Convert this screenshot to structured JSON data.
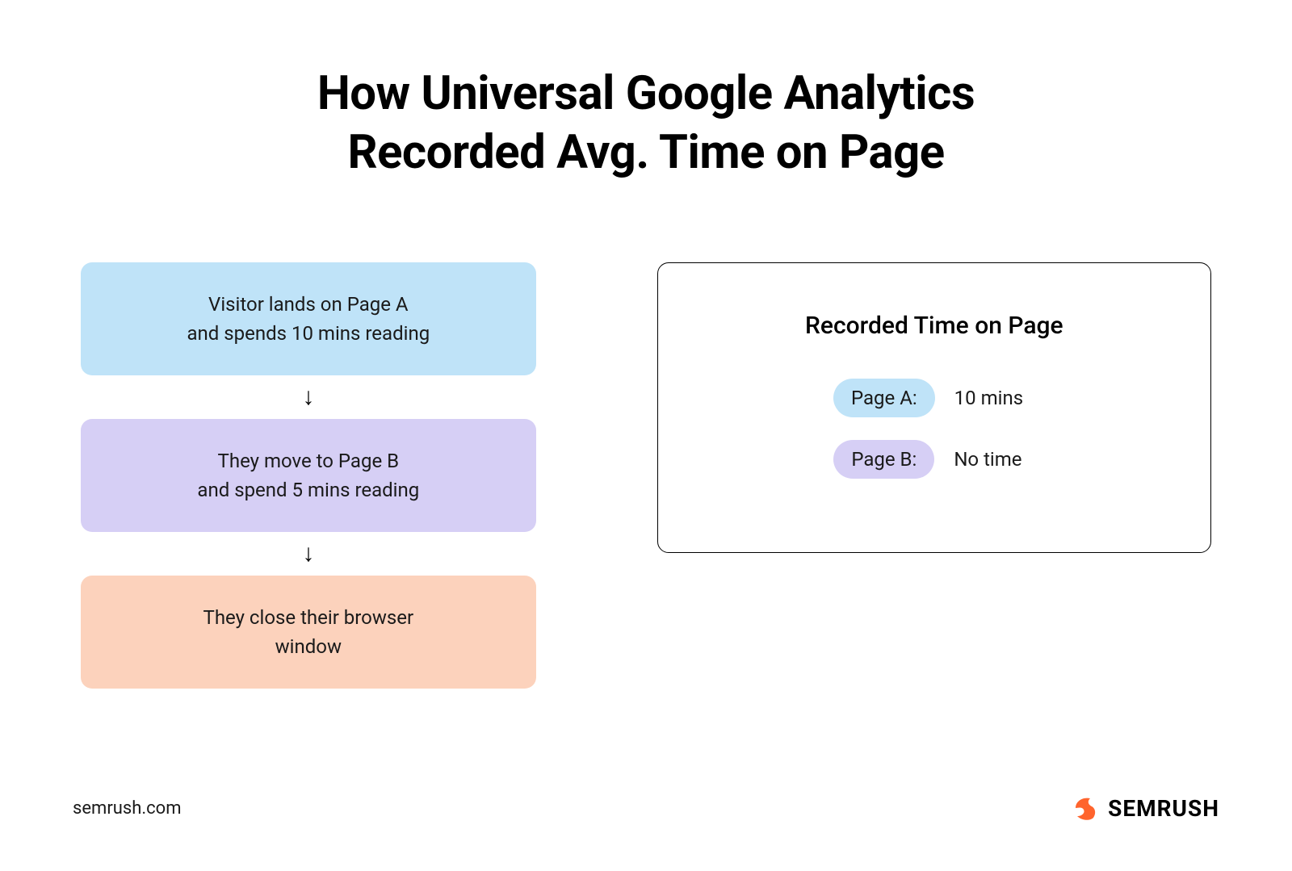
{
  "title_line1": "How Universal Google Analytics",
  "title_line2": "Recorded Avg. Time on Page",
  "flow": {
    "step1_line1": "Visitor lands on Page A",
    "step1_line2": "and spends 10 mins reading",
    "step2_line1": "They move to Page B",
    "step2_line2": "and spend 5 mins reading",
    "step3_line1": "They close their browser",
    "step3_line2": "window"
  },
  "results": {
    "heading": "Recorded Time on Page",
    "rows": [
      {
        "label": "Page A:",
        "value": "10 mins",
        "color": "blue"
      },
      {
        "label": "Page B:",
        "value": "No time",
        "color": "purple"
      }
    ]
  },
  "footer": {
    "url": "semrush.com",
    "brand": "SEMRUSH"
  },
  "colors": {
    "blue": "#bfe3f8",
    "purple": "#d6cff5",
    "orange": "#fcd2bc",
    "brand_orange": "#ff642d"
  }
}
